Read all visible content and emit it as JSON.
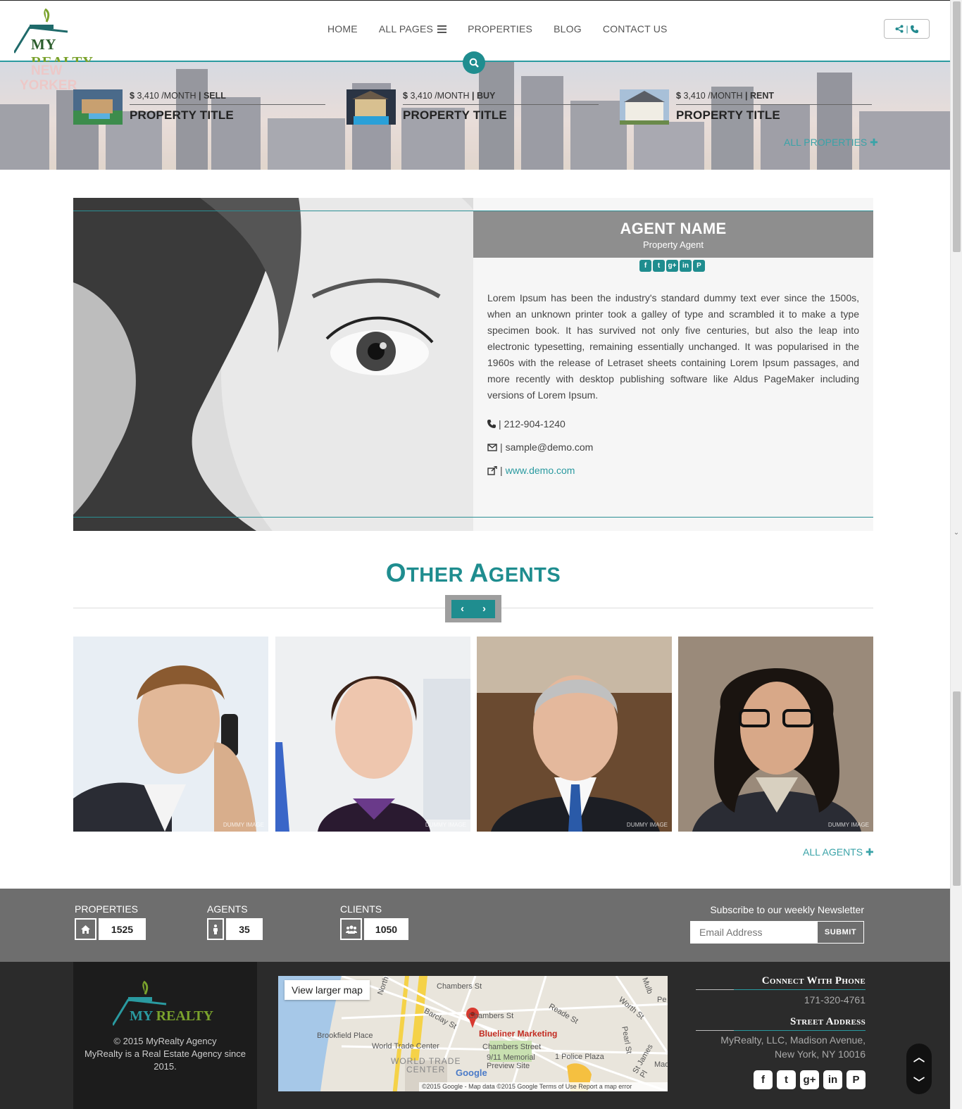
{
  "brand": {
    "name_my": "MY",
    "name_realty": "REALTY"
  },
  "nav": {
    "items": [
      {
        "label": "HOME"
      },
      {
        "label": "ALL PAGES"
      },
      {
        "label": "PROPERTIES"
      },
      {
        "label": "BLOG"
      },
      {
        "label": "CONTACT US"
      }
    ],
    "contact_sep": "|"
  },
  "hero": {
    "properties": [
      {
        "currency": "$",
        "price": "3,410 /MONTH",
        "sep": "|",
        "type": "SELL",
        "title": "PROPERTY TITLE"
      },
      {
        "currency": "$",
        "price": "3,410 /MONTH",
        "sep": "|",
        "type": "BUY",
        "title": "PROPERTY TITLE"
      },
      {
        "currency": "$",
        "price": "3,410 /MONTH",
        "sep": "|",
        "type": "RENT",
        "title": "PROPERTY TITLE"
      }
    ],
    "all_link": "ALL PROPERTIES",
    "sign_text": [
      "NEW",
      "YORKER"
    ]
  },
  "agent": {
    "name": "AGENT NAME",
    "role": "Property Agent",
    "bio": "Lorem Ipsum has been the industry's standard dummy text ever since the 1500s, when an unknown printer took a galley of type and scrambled it to make a type specimen book. It has survived not only five centuries, but also the leap into electronic typesetting, remaining essentially unchanged. It was popularised in the 1960s with the release of Letraset sheets containing Lorem Ipsum passages, and more recently with desktop publishing software like Aldus PageMaker including versions of Lorem Ipsum.",
    "sep": "|",
    "phone": "212-904-1240",
    "email": "sample@demo.com",
    "website": "www.demo.com",
    "social_icons": [
      "facebook-icon",
      "twitter-icon",
      "google-plus-icon",
      "linkedin-icon",
      "pinterest-icon"
    ]
  },
  "other_agents": {
    "title_big_1": "O",
    "title_small_1": "THER ",
    "title_big_2": "A",
    "title_small_2": "GENTS",
    "watermark": "DUMMY IMAGE",
    "all_link": "ALL AGENTS"
  },
  "stats": {
    "items": [
      {
        "label": "PROPERTIES",
        "value": "1525",
        "icon": "home-icon"
      },
      {
        "label": "AGENTS",
        "value": "35",
        "icon": "male-icon"
      },
      {
        "label": "CLIENTS",
        "value": "1050",
        "icon": "users-icon"
      }
    ],
    "newsletter_label": "Subscribe to our weekly Newsletter",
    "newsletter_placeholder": "Email Address",
    "submit_label": "SUBMIT"
  },
  "footer": {
    "copyright_line1": "© 2015 MyRealty Agency",
    "copyright_line2": "MyRealty is a Real Estate Agency since 2015.",
    "map": {
      "button": "View larger map",
      "labels": [
        "Chambers St",
        "Chambers St",
        "Blueliner Marketing",
        "Barclay St",
        "Brookfield Place",
        "World Trade Center",
        "Chambers Street",
        "9/11 Memorial",
        "Preview Site",
        "1 Police Plaza",
        "Reade St",
        "Worth St",
        "Pearl St",
        "St James Pl",
        "WORLD TRADE",
        "CENTER",
        "Google",
        "North",
        "Mulb",
        "Mad",
        "Pe"
      ],
      "footer_text": "©2015 Google - Map data ©2015 Google   Terms of Use   Report a map error"
    },
    "phone_heading": "Connect With Phone",
    "phone": "171-320-4761",
    "address_heading": "Street Address",
    "address": "MyRealty, LLC, Madison Avenue, New York, NY 10016"
  },
  "colors": {
    "accent": "#1f8d8f",
    "link": "#2a9aa0",
    "stats_bg": "#6e6e6e",
    "footer_bg": "#2b2b2b"
  }
}
